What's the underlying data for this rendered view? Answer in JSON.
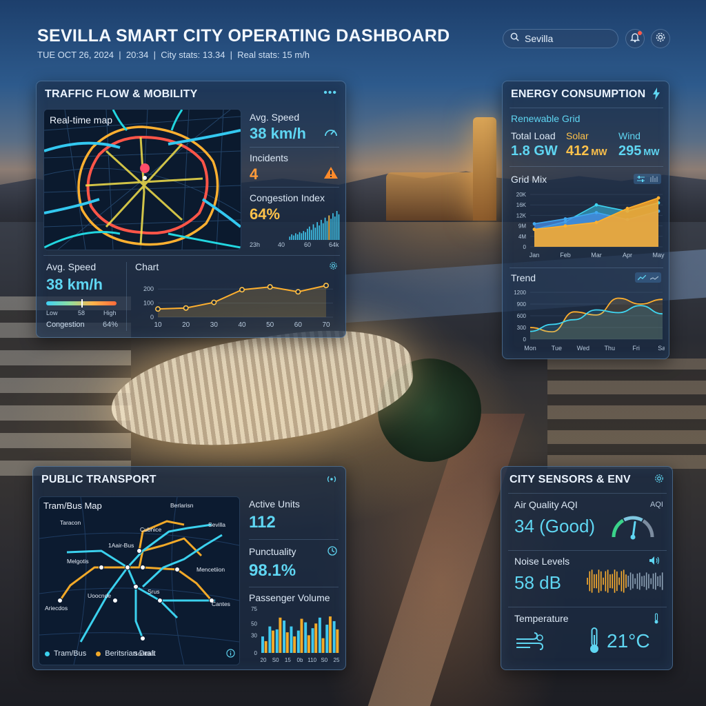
{
  "header": {
    "title": "SEVILLA SMART CITY OPERATING DASHBOARD",
    "subtitle": "TUE OCT 26, 2024  |  20:34  |  City stats: 13.34  |  Real stats: 15 m/h",
    "search_value": "Sevilla"
  },
  "traffic": {
    "title": "TRAFFIC FLOW & MOBILITY",
    "map_label": "Real-time map",
    "avg_speed_label": "Avg. Speed",
    "avg_speed_value": "38 km/h",
    "incidents_label": "Incidents",
    "incidents_value": "4",
    "congestion_label": "Congestion Index",
    "congestion_value": "64%",
    "congestion_ticks": [
      "23h",
      "40",
      "60",
      "64k"
    ],
    "congestion_bars": [
      3,
      5,
      4,
      6,
      5,
      7,
      6,
      8,
      7,
      10,
      12,
      9,
      14,
      11,
      16,
      13,
      18,
      15,
      20,
      17,
      22,
      19,
      24,
      21,
      26,
      23
    ],
    "bottom_speed_label": "Avg. Speed",
    "bottom_speed_value": "38 km/h",
    "gauge_low": "Low",
    "gauge_mid": "58",
    "gauge_high": "High",
    "gauge_fraction": 0.5,
    "congestion_small_label": "Congestion",
    "congestion_small_value": "64%",
    "chart_title": "Chart"
  },
  "energy": {
    "title": "ENERGY CONSUMPTION",
    "subtitle": "Renewable Grid",
    "total_load_label": "Total Load",
    "total_load_value": "1.8 GW",
    "solar_label": "Solar",
    "solar_value": "412",
    "solar_unit": "MW",
    "wind_label": "Wind",
    "wind_value": "295",
    "wind_unit": "MW",
    "grid_mix_title": "Grid Mix",
    "trend_title": "Trend"
  },
  "transport": {
    "title": "PUBLIC TRANSPORT",
    "map_label": "Tram/Bus Map",
    "stations": [
      "Taracon",
      "Berlarisn",
      "Cubnice",
      "Sevilla",
      "1Aair-Bus",
      "Melgotis",
      "Mencetiion",
      "Uoocnde",
      "Srus",
      "Ariecdos",
      "Cantes",
      "Sonitias"
    ],
    "legend_tram": "Tram/Bus",
    "legend_draft": "Beritsrian Draft",
    "active_units_label": "Active Units",
    "active_units_value": "112",
    "punctuality_label": "Punctuality",
    "punctuality_value": "98.1%",
    "passenger_label": "Passenger Volume"
  },
  "sensors": {
    "title": "CITY SENSORS & ENV",
    "aqi_label": "Air Quality AQI",
    "aqi_tag": "AQI",
    "aqi_value": "34 (Good)",
    "aqi_gauge_fraction": 0.34,
    "noise_label": "Noise Levels",
    "noise_value": "58 dB",
    "temp_label": "Temperature",
    "temp_value": "21°C"
  },
  "colors": {
    "accent_cyan": "#5fd6f2",
    "accent_orange": "#ff9a3a",
    "accent_yellow": "#ffc24a",
    "alert_red": "#ff5a4a"
  },
  "chart_data": [
    {
      "type": "line",
      "title": "Chart",
      "x": [
        10,
        20,
        30,
        40,
        50,
        60,
        70
      ],
      "series": [
        {
          "values": [
            58,
            65,
            105,
            195,
            215,
            180,
            225
          ]
        }
      ],
      "xlim": [
        10,
        70
      ],
      "ylim": [
        0,
        250
      ],
      "yticks": [
        0,
        100,
        200
      ]
    },
    {
      "type": "area",
      "title": "Grid Mix",
      "categories": [
        "Jan",
        "Feb",
        "Mar",
        "Apr",
        "May"
      ],
      "yticks": [
        "0",
        "4M",
        "9M",
        "12K",
        "16K",
        "20K"
      ],
      "series": [
        {
          "values": [
            5,
            6,
            7,
            11,
            14
          ]
        },
        {
          "values": [
            6.6,
            8,
            9.8,
            7.8,
            10.2
          ]
        },
        {
          "values": [
            5,
            7.2,
            12,
            10.2,
            12.6
          ]
        }
      ]
    },
    {
      "type": "line",
      "title": "Trend",
      "categories": [
        "Mon",
        "Tue",
        "Wed",
        "Thu",
        "Fri",
        "Sat"
      ],
      "ylim": [
        0,
        1200
      ],
      "yticks": [
        0,
        300,
        600,
        900,
        1200
      ],
      "series": [
        {
          "values": [
            300,
            190,
            700,
            620,
            1050,
            900,
            1020
          ]
        },
        {
          "values": [
            200,
            380,
            500,
            750,
            680,
            860,
            650
          ]
        }
      ]
    },
    {
      "type": "bar",
      "title": "Passenger Volume",
      "categories": [
        "20",
        "S0",
        "15",
        "0b",
        "110",
        "S0",
        "25"
      ],
      "yticks": [
        0,
        30,
        50,
        75
      ],
      "series": [
        {
          "values": [
            28,
            45,
            40,
            55,
            45,
            38,
            52,
            42,
            60,
            48,
            54
          ]
        },
        {
          "values": [
            20,
            38,
            60,
            35,
            28,
            58,
            30,
            50,
            25,
            62,
            40
          ]
        }
      ]
    }
  ]
}
